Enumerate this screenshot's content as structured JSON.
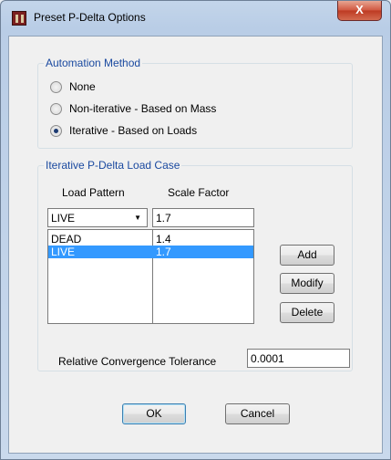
{
  "window": {
    "title": "Preset P-Delta Options",
    "close_glyph": "X",
    "app_icon": "etabs-app-icon"
  },
  "automation": {
    "group_title": "Automation Method",
    "options": [
      {
        "label": "None",
        "selected": false
      },
      {
        "label": "Non-iterative - Based on Mass",
        "selected": false
      },
      {
        "label": "Iterative - Based on Loads",
        "selected": true
      }
    ]
  },
  "load_case": {
    "group_title": "Iterative P-Delta Load Case",
    "col_load_pattern": "Load Pattern",
    "col_scale_factor": "Scale Factor",
    "combo_value": "LIVE",
    "scale_value": "1.7",
    "rows": [
      {
        "pattern": "DEAD",
        "factor": "1.4",
        "selected": false
      },
      {
        "pattern": "LIVE",
        "factor": "1.7",
        "selected": true
      }
    ],
    "add_label": "Add",
    "modify_label": "Modify",
    "delete_label": "Delete"
  },
  "tolerance": {
    "label": "Relative Convergence Tolerance",
    "value": "0.0001"
  },
  "footer": {
    "ok_label": "OK",
    "cancel_label": "Cancel"
  }
}
